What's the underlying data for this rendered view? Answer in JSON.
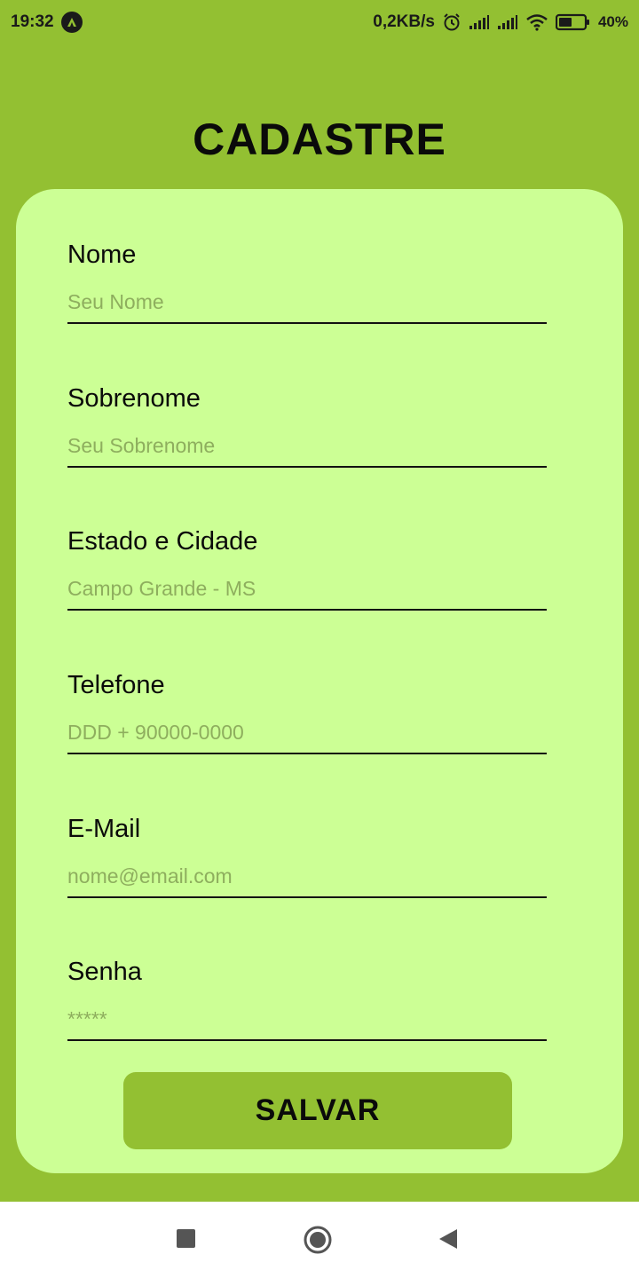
{
  "status_bar": {
    "time": "19:32",
    "net_speed": "0,2KB/s",
    "battery": "40%",
    "icons": [
      "app-notification-icon",
      "alarm-icon",
      "signal-icon",
      "signal-icon",
      "wifi-icon",
      "battery-icon"
    ]
  },
  "title": "CADASTRE",
  "form": {
    "fields": [
      {
        "label": "Nome",
        "placeholder": "Seu Nome",
        "value": ""
      },
      {
        "label": "Sobrenome",
        "placeholder": "Seu Sobrenome",
        "value": ""
      },
      {
        "label": "Estado e Cidade",
        "placeholder": "Campo Grande - MS",
        "value": ""
      },
      {
        "label": "Telefone",
        "placeholder": "DDD + 90000-0000",
        "value": ""
      },
      {
        "label": "E-Mail",
        "placeholder": "nome@email.com",
        "value": ""
      },
      {
        "label": "Senha",
        "placeholder": "*****",
        "value": ""
      }
    ],
    "submit_label": "SALVAR"
  },
  "nav_bar": {
    "icons": [
      "recent-apps-icon",
      "home-icon",
      "back-icon"
    ]
  },
  "colors": {
    "background": "#93c032",
    "card": "#ccff95",
    "button": "#93c032",
    "placeholder": "#8eae5e"
  }
}
